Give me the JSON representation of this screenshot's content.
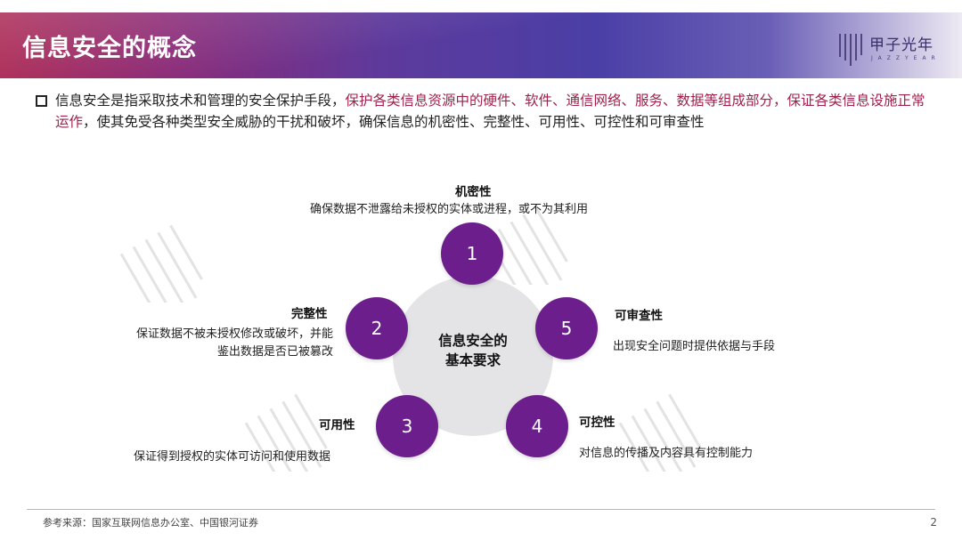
{
  "header": {
    "title": "信息安全的概念",
    "logo_text": "甲子光年",
    "logo_sub": "JAZZYEAR"
  },
  "intro": {
    "part1": "信息安全是指采取技术和管理的安全保护手段，",
    "part2": "保护各类信息资源中的硬件、软件、通信网络、服务、数据等组成部分，保证各类信息设施正常运作",
    "part3": "，使其免受各种类型安全威胁的干扰和破坏，确保信息的机密性、完整性、可用性、可控性和可审查性",
    "highlight_color": "#a0204c"
  },
  "center": {
    "line1": "信息安全的",
    "line2": "基本要求"
  },
  "items": [
    {
      "number": "1",
      "title": "机密性",
      "desc": "确保数据不泄露给未授权的实体或进程，或不为其利用"
    },
    {
      "number": "2",
      "title": "完整性",
      "desc_line1": "保证数据不被未授权修改或破坏，并能",
      "desc_line2": "鉴出数据是否已被篡改"
    },
    {
      "number": "3",
      "title": "可用性",
      "desc": "保证得到授权的实体可访问和使用数据"
    },
    {
      "number": "4",
      "title": "可控性",
      "desc": "对信息的传播及内容具有控制能力"
    },
    {
      "number": "5",
      "title": "可审查性",
      "desc": "出现安全问题时提供依据与手段"
    }
  ],
  "colors": {
    "node": "#6c1f8c",
    "center": "#e4e4e6"
  },
  "footer": {
    "source": "参考来源：国家互联网信息办公室、中国银河证券",
    "page": "2"
  }
}
